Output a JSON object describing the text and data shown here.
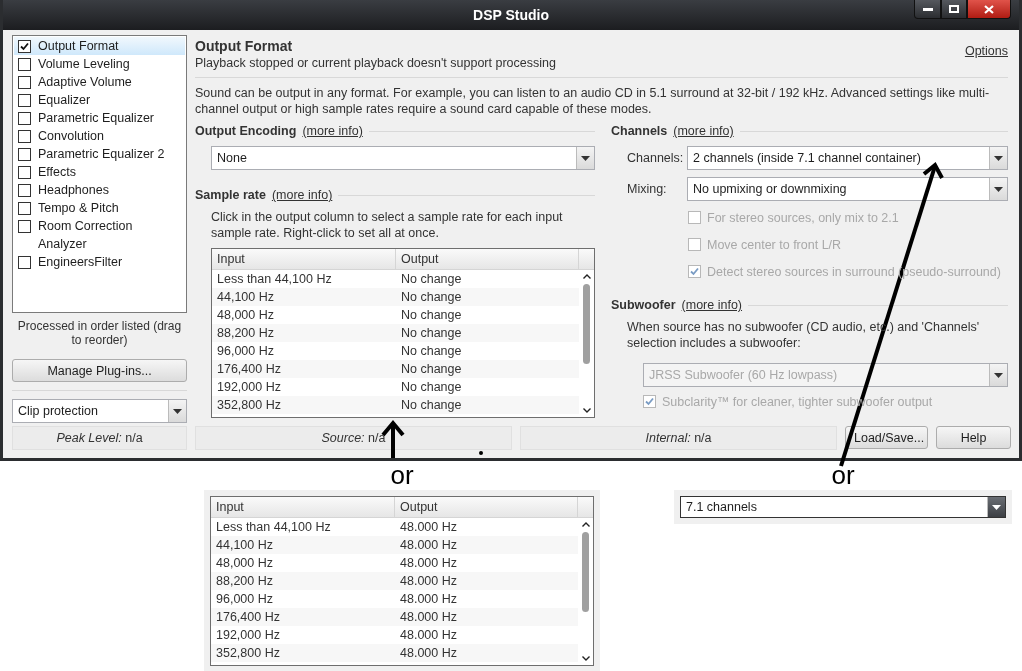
{
  "window": {
    "title": "DSP Studio"
  },
  "sidebar": {
    "items": [
      {
        "label": "Output Format",
        "kind": "checkbox",
        "checked": true,
        "selected": true
      },
      {
        "label": "Volume Leveling",
        "kind": "checkbox",
        "checked": false,
        "selected": false
      },
      {
        "label": "Adaptive Volume",
        "kind": "checkbox",
        "checked": false,
        "selected": false
      },
      {
        "label": "Equalizer",
        "kind": "checkbox",
        "checked": false,
        "selected": false
      },
      {
        "label": "Parametric Equalizer",
        "kind": "checkbox",
        "checked": false,
        "selected": false
      },
      {
        "label": "Convolution",
        "kind": "checkbox",
        "checked": false,
        "selected": false
      },
      {
        "label": "Parametric Equalizer 2",
        "kind": "checkbox",
        "checked": false,
        "selected": false
      },
      {
        "label": "Effects",
        "kind": "checkbox",
        "checked": false,
        "selected": false
      },
      {
        "label": "Headphones",
        "kind": "checkbox",
        "checked": false,
        "selected": false
      },
      {
        "label": "Tempo & Pitch",
        "kind": "checkbox",
        "checked": false,
        "selected": false
      },
      {
        "label": "Room Correction",
        "kind": "checkbox",
        "checked": false,
        "selected": false
      },
      {
        "label": "Analyzer",
        "kind": "plain",
        "selected": false
      },
      {
        "label": "EngineersFilter",
        "kind": "checkbox",
        "checked": false,
        "selected": false
      }
    ],
    "note": "Processed in order listed (drag to reorder)",
    "manage_button": "Manage Plug-ins...",
    "clip_select": {
      "value": "Clip protection"
    }
  },
  "header": {
    "title": "Output Format",
    "subtitle": "Playback stopped or current playback doesn't support processing",
    "options_link": "Options"
  },
  "intro": "Sound can be output in any format.  For example, you can listen to an audio CD in 5.1 surround at 32-bit / 192 kHz.  Advanced settings like multi-channel output or high sample rates require a sound card capable of these modes.",
  "output_encoding": {
    "title": "Output Encoding",
    "link": "(more info)",
    "select": {
      "value": "None"
    }
  },
  "sample_rate": {
    "title": "Sample rate",
    "link": "(more info)",
    "description": "Click in the output column to select a sample rate for each input sample rate.  Right-click to set all at once.",
    "table": {
      "columns": [
        "Input",
        "Output"
      ],
      "rows": [
        [
          "Less than 44,100 Hz",
          "No change"
        ],
        [
          "44,100 Hz",
          "No change"
        ],
        [
          "48,000 Hz",
          "No change"
        ],
        [
          "88,200 Hz",
          "No change"
        ],
        [
          "96,000 Hz",
          "No change"
        ],
        [
          "176,400 Hz",
          "No change"
        ],
        [
          "192,000 Hz",
          "No change"
        ],
        [
          "352,800 Hz",
          "No change"
        ]
      ]
    }
  },
  "channels": {
    "title": "Channels",
    "link": "(more info)",
    "fields": [
      {
        "label": "Channels:",
        "value": "2 channels (inside 7.1 channel container)"
      },
      {
        "label": "Mixing:",
        "value": "No upmixing or downmixing"
      }
    ],
    "options": [
      {
        "label": "For stereo sources, only mix to 2.1",
        "checked": false,
        "disabled": true
      },
      {
        "label": "Move center to front L/R",
        "checked": false,
        "disabled": true
      },
      {
        "label": "Detect stereo sources in surround (pseudo-surround)",
        "checked": true,
        "disabled": true
      }
    ]
  },
  "subwoofer": {
    "title": "Subwoofer",
    "link": "(more info)",
    "description": "When source has no subwoofer (CD audio, etc.) and 'Channels' selection includes a subwoofer:",
    "select": {
      "value": "JRSS Subwoofer (60 Hz lowpass)",
      "disabled": true
    },
    "option": {
      "label": "Subclarity™ for cleaner, tighter subwoofer output",
      "checked": true,
      "disabled": true
    }
  },
  "status_bar": [
    "*Peak Level:* n/a",
    "*Source:* n/a",
    "*Internal:* n/a"
  ],
  "buttons": [
    "Load/Save...",
    "Help"
  ],
  "annotations": [
    {
      "kind": "table",
      "caption": "or",
      "table": {
        "columns": [
          "Input",
          "Output"
        ],
        "rows": [
          [
            "Less than 44,100 Hz",
            "48.000 Hz"
          ],
          [
            "44,100 Hz",
            "48.000 Hz"
          ],
          [
            "48,000 Hz",
            "48.000 Hz"
          ],
          [
            "88,200 Hz",
            "48.000 Hz"
          ],
          [
            "96,000 Hz",
            "48.000 Hz"
          ],
          [
            "176,400 Hz",
            "48.000 Hz"
          ],
          [
            "192,000 Hz",
            "48.000 Hz"
          ],
          [
            "352,800 Hz",
            "48.000 Hz"
          ]
        ]
      }
    },
    {
      "kind": "select",
      "caption": "or",
      "value": "7.1 channels"
    }
  ]
}
